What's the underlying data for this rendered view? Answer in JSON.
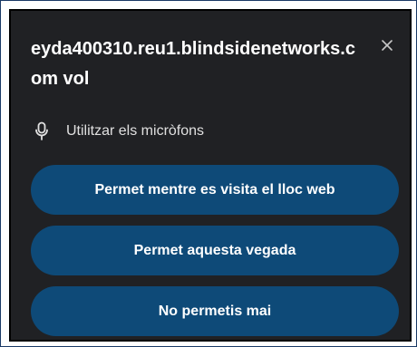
{
  "dialog": {
    "title": "eyda400310.reu1.blindsidenetworks.com vol",
    "permission": {
      "icon": "microphone-icon",
      "label": "Utilitzar els micròfons"
    },
    "buttons": {
      "allow_while_visiting": "Permet mentre es visita el lloc web",
      "allow_this_time": "Permet aquesta vegada",
      "never_allow": "No permetis mai"
    },
    "close_icon": "close-icon"
  },
  "colors": {
    "dialog_background": "#202124",
    "button_background": "#0e4a78",
    "text": "#ffffff"
  }
}
